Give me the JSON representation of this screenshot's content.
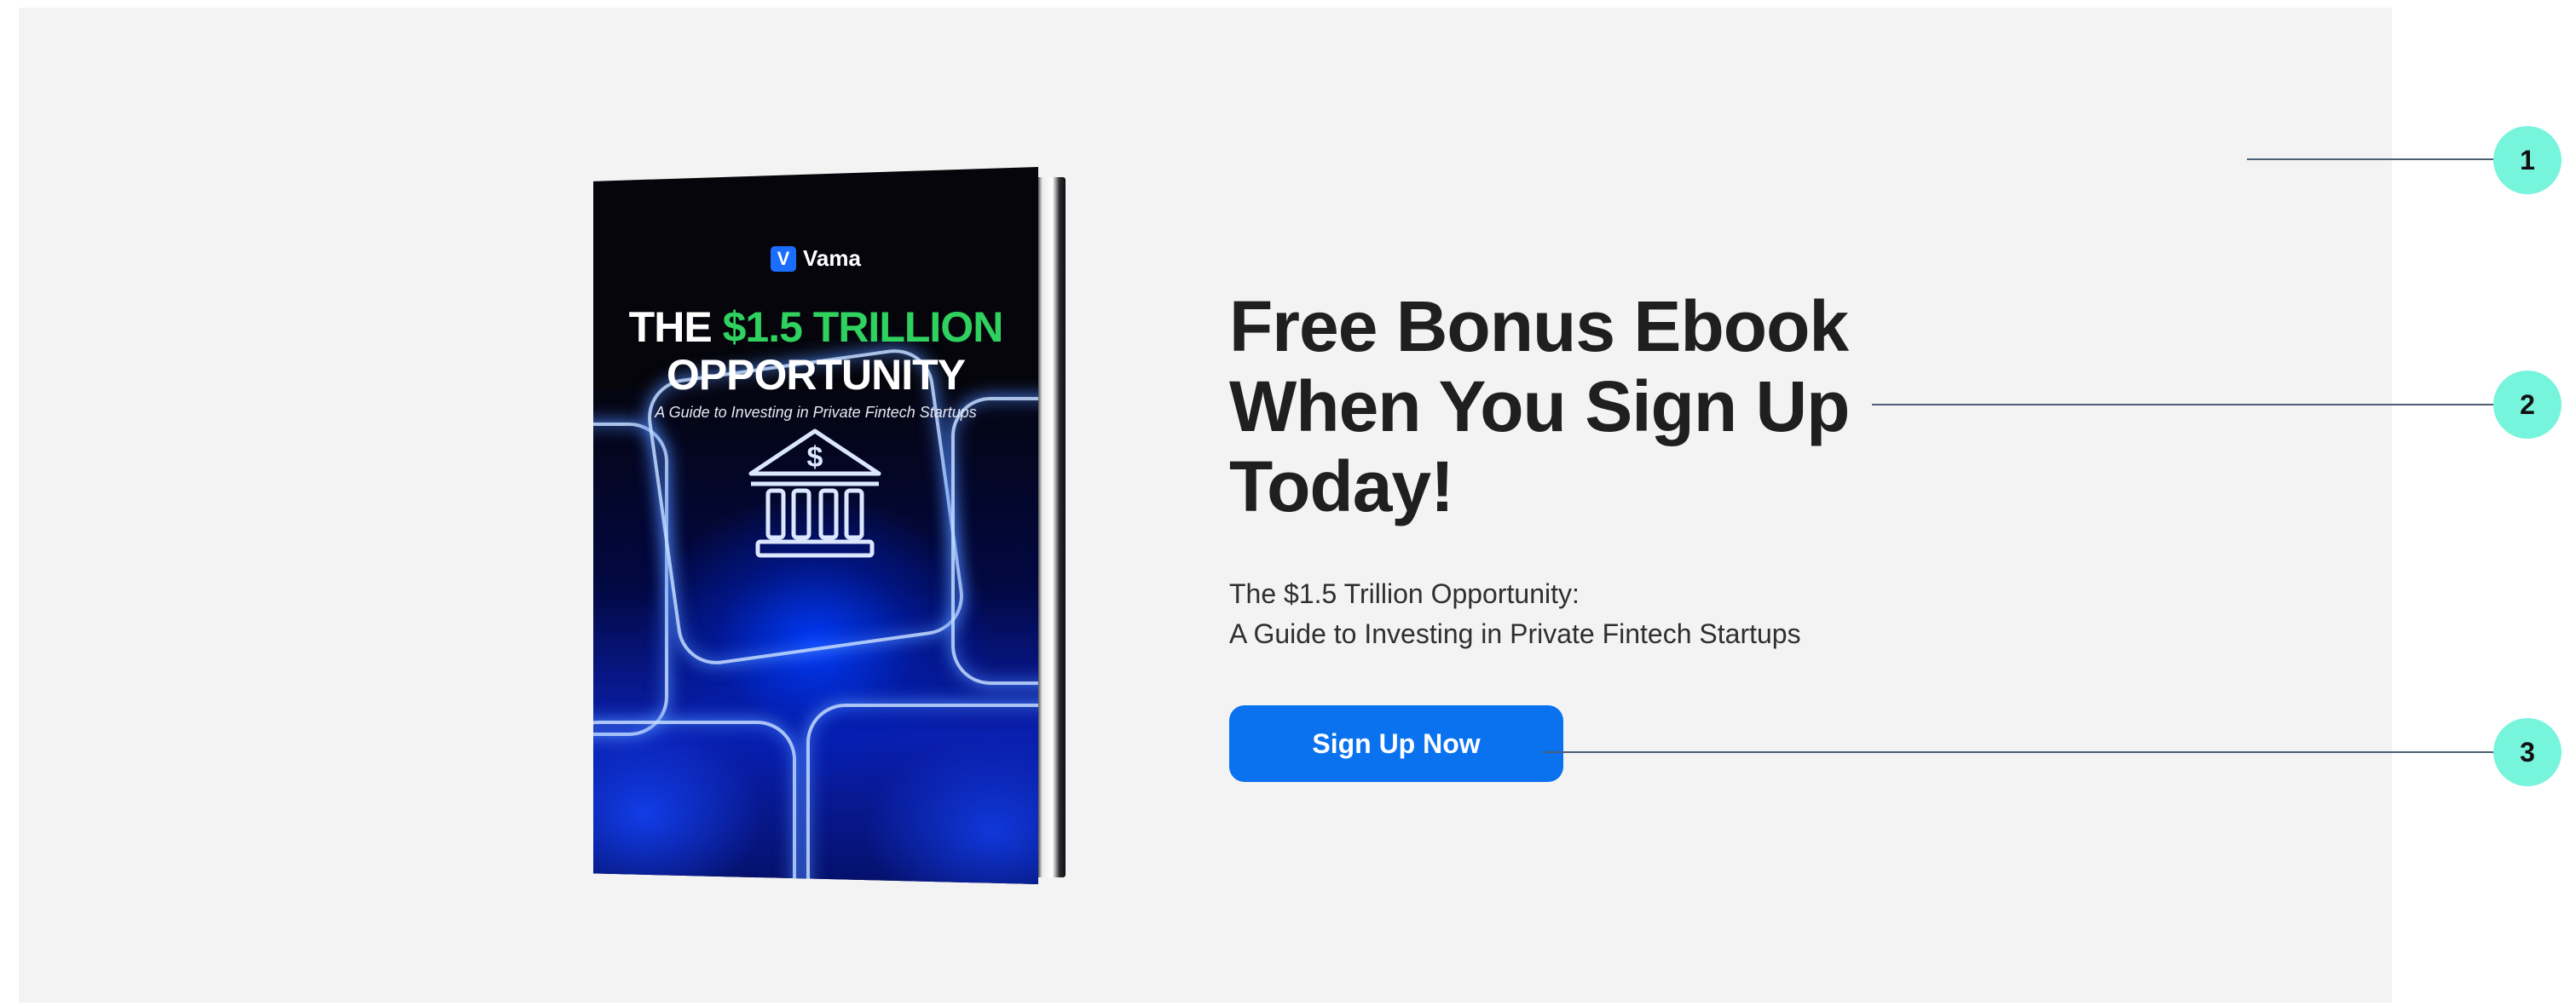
{
  "book": {
    "brand": "Vama",
    "brand_mark": "V",
    "title_prefix": "THE ",
    "title_highlight": "$1.5 TRILLION",
    "title_line2": "OPPORTUNITY",
    "subtitle": "A Guide to Investing in Private Fintech Startups",
    "icon": "bank-dollar-icon"
  },
  "hero": {
    "heading": "Free Bonus Ebook When You Sign Up Today!",
    "subtitle_line1": "The $1.5 Trillion Opportunity:",
    "subtitle_line2": "A Guide to Investing in Private Fintech Startups",
    "cta_label": "Sign Up Now"
  },
  "callouts": [
    "1",
    "2",
    "3"
  ],
  "colors": {
    "panel_bg": "#f3f3f3",
    "heading_text": "#1f1f1f",
    "cta_bg": "#0a72ef",
    "cover_accent_green": "#2fd15f",
    "marker_bg": "#77f4dc",
    "leader_line": "#4c5d74"
  }
}
